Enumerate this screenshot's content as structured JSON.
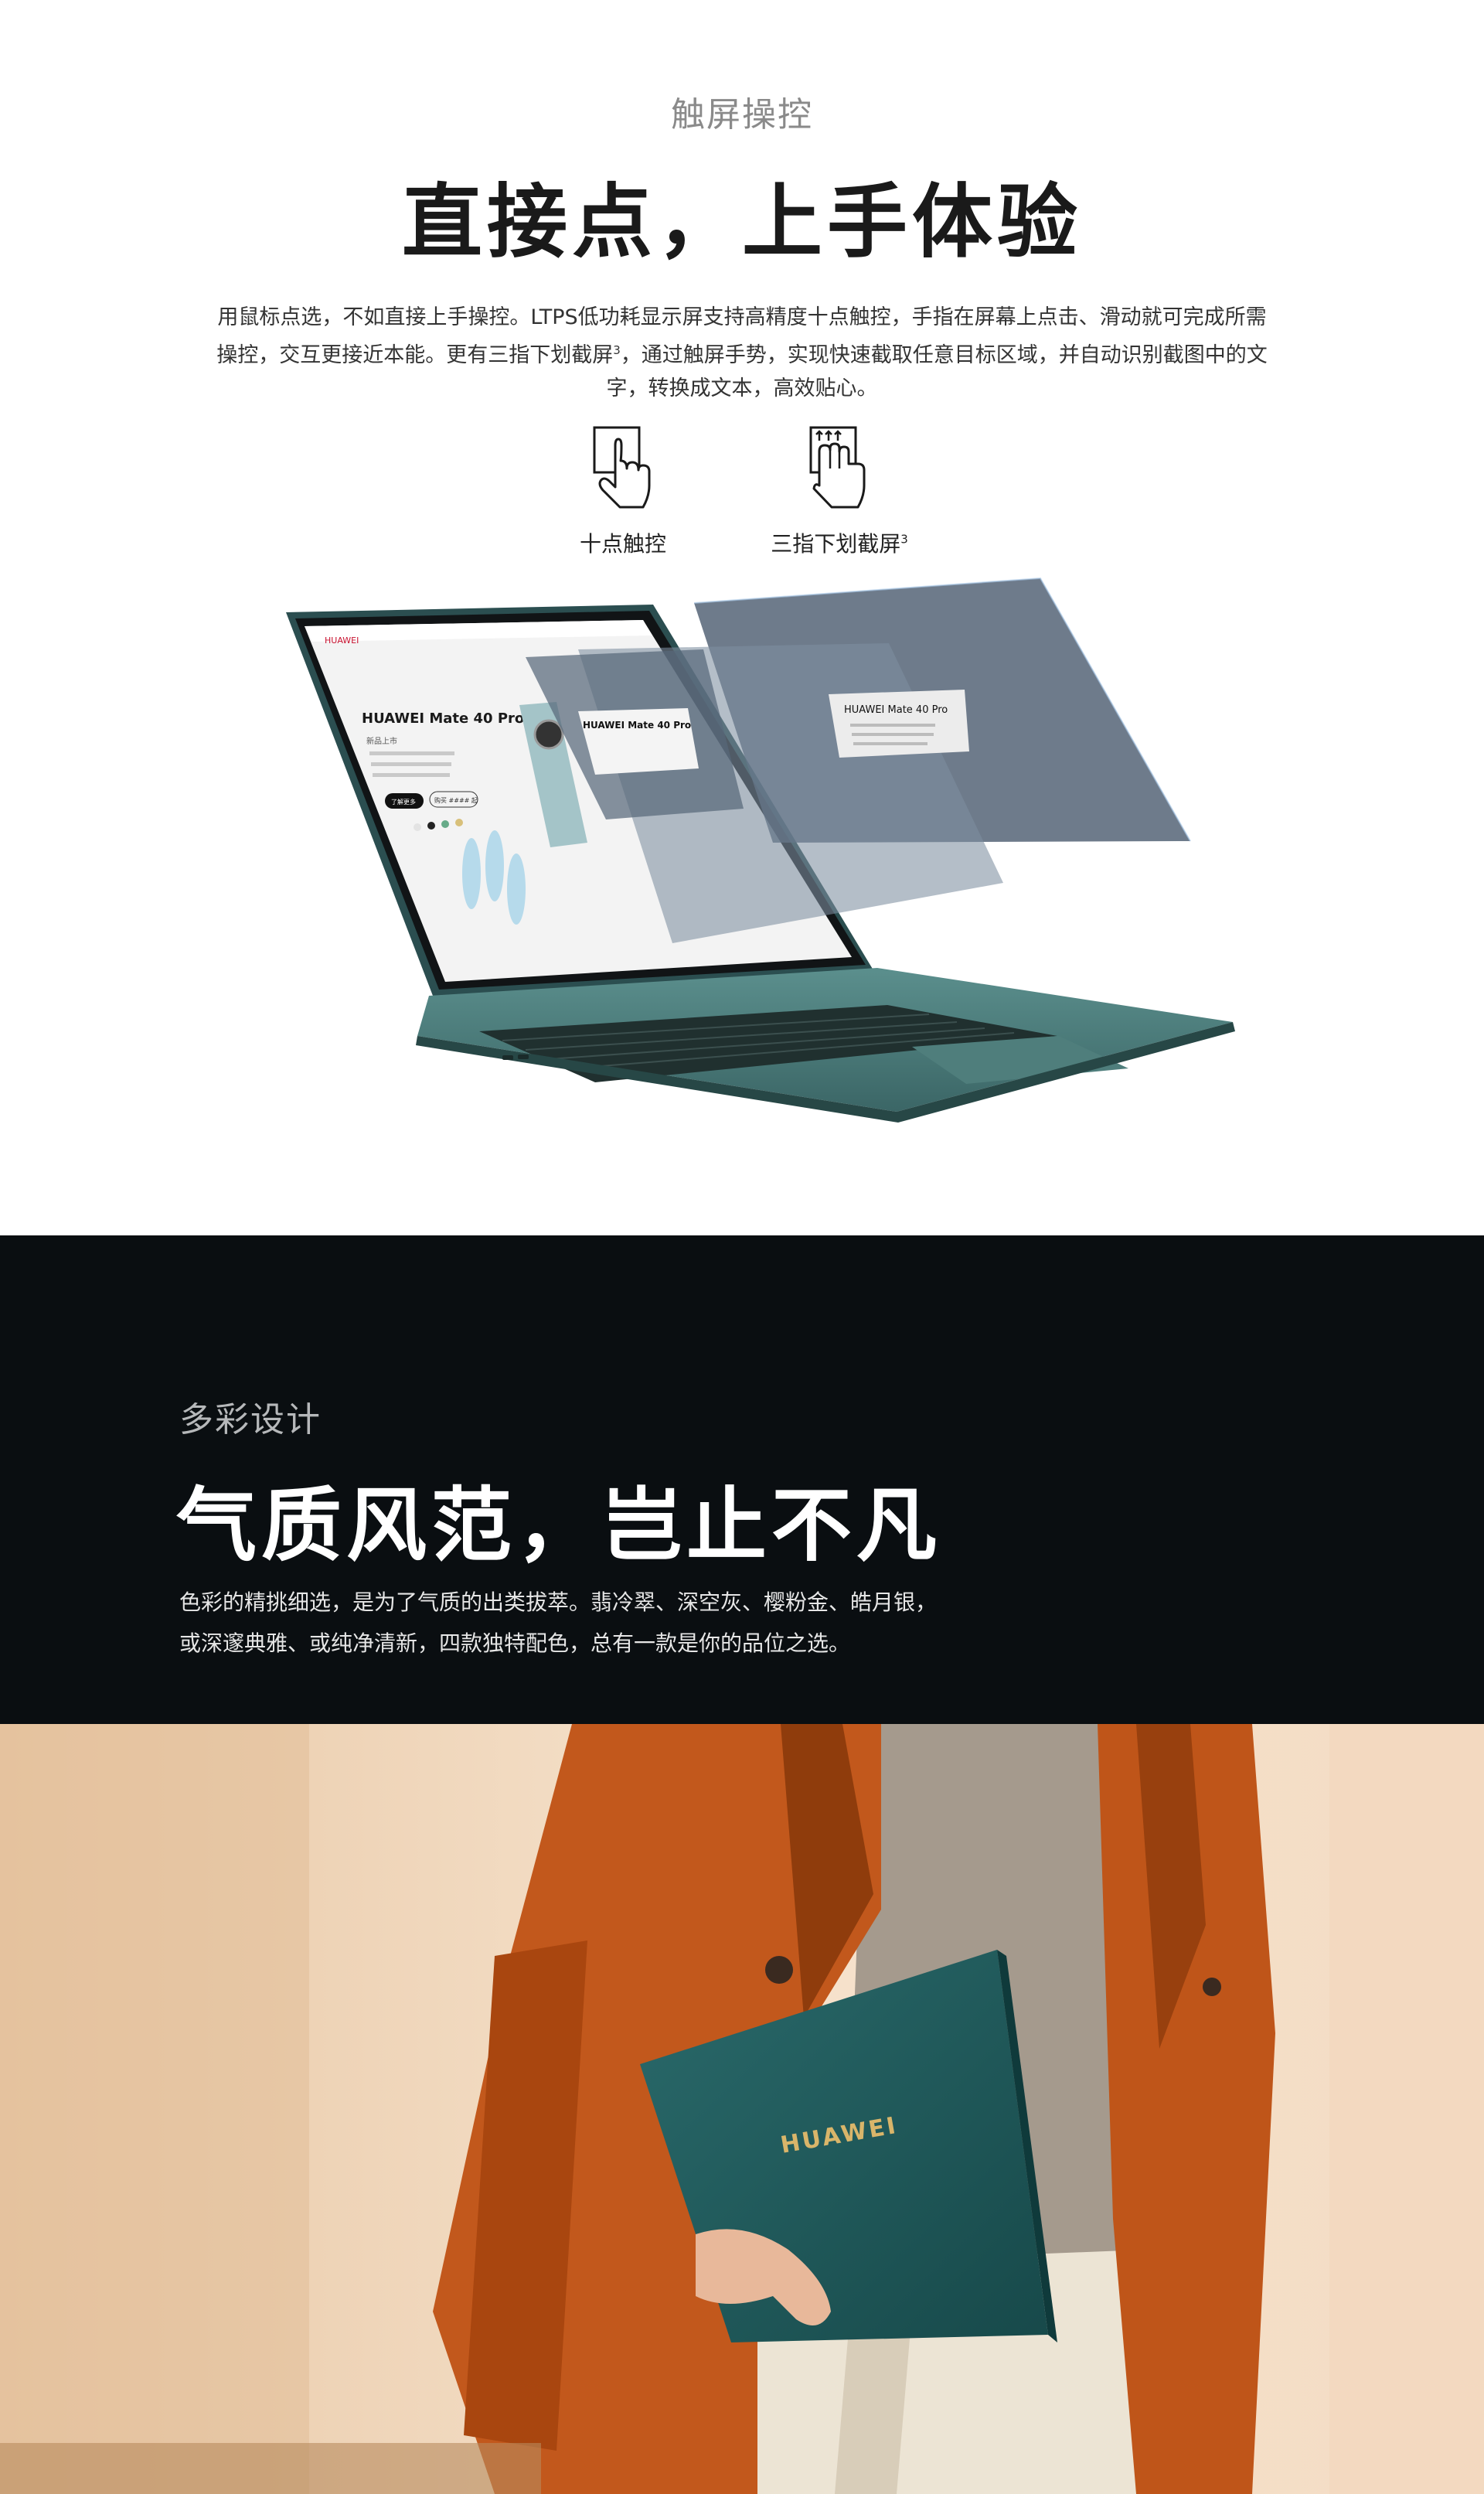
{
  "touch_section": {
    "eyebrow": "触屏操控",
    "headline": "直接点，上手体验",
    "description_part1": "用鼠标点选，不如直接上手操控。LTPS低功耗显示屏支持高精度十点触控，手指在屏幕上点击、滑动就可完成所需操控，交互更接近本能。更有三指下划截屏",
    "description_sup": "3",
    "description_part2": "，通过触屏手势，实现快速截取任意目标区域，并自动识别截图中的文字，转换成文本，高效贴心。",
    "features": [
      {
        "label": "十点触控",
        "sup": "",
        "icon": "single-finger-tap-icon"
      },
      {
        "label": "三指下划截屏",
        "sup": "3",
        "icon": "three-finger-swipe-icon"
      }
    ],
    "laptop_screen": {
      "brand": "HUAWEI",
      "product_title": "HUAWEI Mate 40 Pro",
      "subtitle": "新品上市",
      "buy_button": "了解更多",
      "secondary_button": "购买 #### 起",
      "overlay_title_1": "HUAWEI Mate 40 Pro",
      "overlay_title_2": "HUAWEI Mate 40 Pro"
    },
    "colors": {
      "frame": "#3f6d6e",
      "frame_dark": "#2b4e50",
      "overlay": "#3c4e60"
    }
  },
  "color_section": {
    "eyebrow": "多彩设计",
    "headline": "气质风范，岂止不凡",
    "description_line1": "色彩的精挑细选，是为了气质的出类拔萃。翡冷翠、深空灰、樱粉金、皓月银，",
    "description_line2": "或深邃典雅、或纯净清新，四款独特配色，总有一款是你的品位之选。",
    "bg_color": "#0a0e11"
  },
  "photo_section": {
    "laptop_logo": "HUAWEI",
    "colors": {
      "coat": "#c2581c",
      "laptop": "#1f5b5c",
      "wall": "#f1d8bd",
      "trousers": "#ece4d4"
    }
  }
}
